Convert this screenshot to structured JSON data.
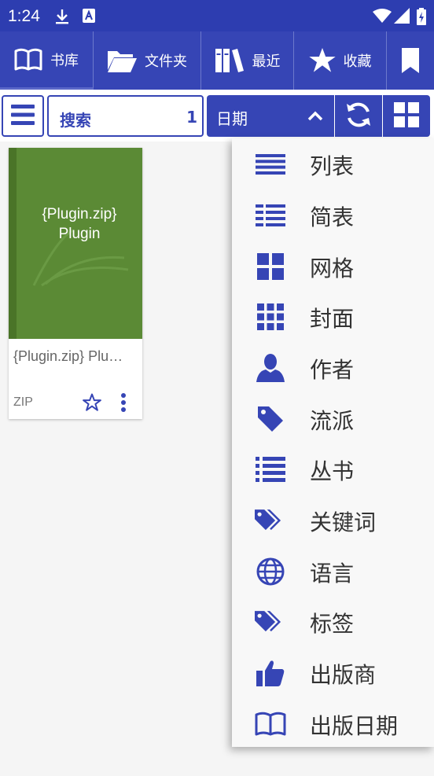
{
  "status_bar": {
    "time": "1:24"
  },
  "tabs": [
    {
      "label": "书库",
      "icon": "open-book-icon"
    },
    {
      "label": "文件夹",
      "icon": "folder-icon"
    },
    {
      "label": "最近",
      "icon": "books-icon"
    },
    {
      "label": "收藏",
      "icon": "star-icon"
    },
    {
      "label": "",
      "icon": "bookmark-icon"
    }
  ],
  "toolbar": {
    "search_label": "搜索",
    "search_count": "1",
    "sort_label": "日期"
  },
  "book": {
    "cover_title_line1": "{Plugin.zip}",
    "cover_title_line2": "Plugin",
    "title": "{Plugin.zip} Plu…",
    "format": "ZIP"
  },
  "view_menu": {
    "items": [
      {
        "label": "列表",
        "icon": "list-icon"
      },
      {
        "label": "简表",
        "icon": "compact-list-icon"
      },
      {
        "label": "网格",
        "icon": "grid-icon"
      },
      {
        "label": "封面",
        "icon": "cover-grid-icon"
      },
      {
        "label": "作者",
        "icon": "person-icon"
      },
      {
        "label": "流派",
        "icon": "tag-icon"
      },
      {
        "label": "丛书",
        "icon": "bulleted-list-icon"
      },
      {
        "label": "关键词",
        "icon": "tags-icon"
      },
      {
        "label": "语言",
        "icon": "globe-icon"
      },
      {
        "label": "标签",
        "icon": "tags-icon"
      },
      {
        "label": "出版商",
        "icon": "thumbs-up-icon"
      },
      {
        "label": "出版日期",
        "icon": "open-book-icon"
      }
    ]
  },
  "colors": {
    "primary": "#3645b5",
    "statusbar": "#2d3db0",
    "cover": "#5b8a35"
  }
}
